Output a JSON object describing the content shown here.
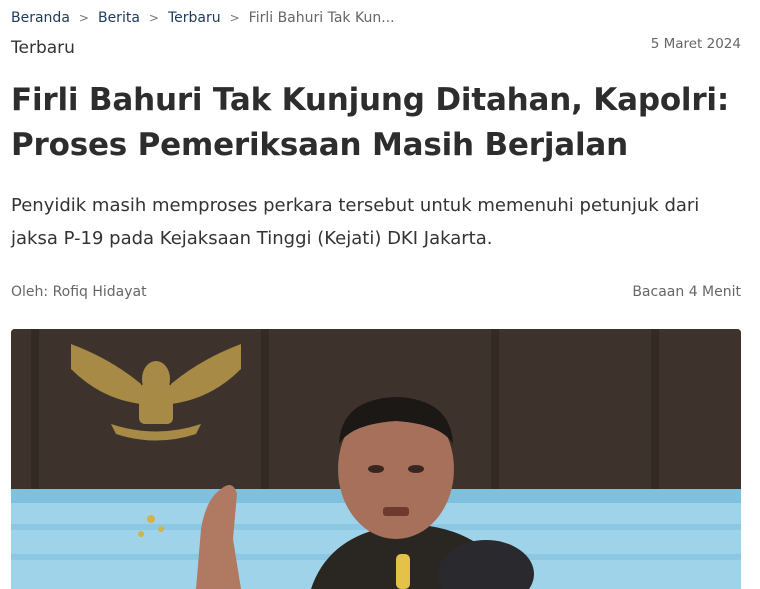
{
  "breadcrumb": {
    "items": [
      "Beranda",
      "Berita",
      "Terbaru"
    ],
    "current": "Firli Bahuri Tak Kun...",
    "separator": ">"
  },
  "article": {
    "category": "Terbaru",
    "date": "5 Maret 2024",
    "title": "Firli Bahuri Tak Kunjung Ditahan, Kapolri: Proses Pemeriksaan Masih Berjalan",
    "lead": "Penyidik masih memproses perkara tersebut untuk memenuhi petunjuk dari jaksa P-19 pada Kejaksaan Tinggi (Kejati) DKI Jakarta.",
    "author": "Oleh: Rofiq Hidayat",
    "read_time": "Bacaan 4 Menit"
  },
  "colors": {
    "link": "#1d3a5c",
    "title": "#2d2d2d",
    "muted": "#666666"
  }
}
